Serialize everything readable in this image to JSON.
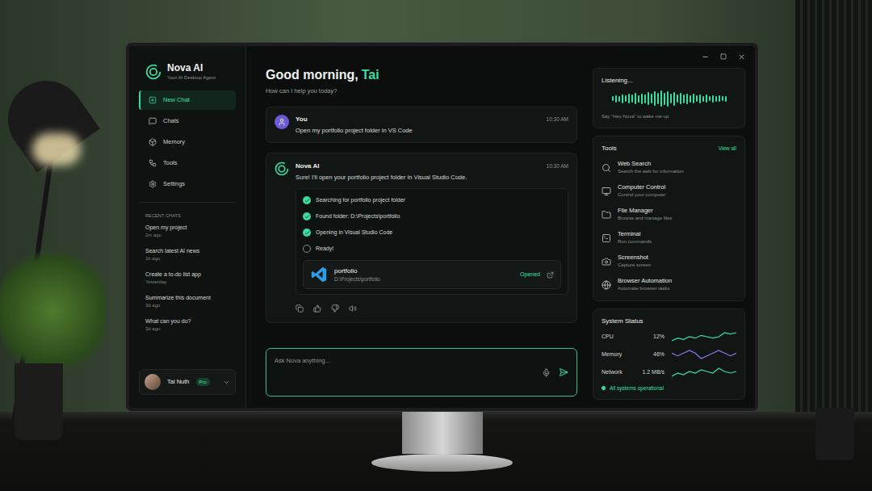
{
  "app": {
    "name": "Nova AI",
    "tagline": "Your AI Desktop Agent"
  },
  "sidebar": {
    "items": [
      {
        "label": "New Chat",
        "selected": true
      },
      {
        "label": "Chats",
        "selected": false
      },
      {
        "label": "Memory",
        "selected": false
      },
      {
        "label": "Tools",
        "selected": false
      },
      {
        "label": "Settings",
        "selected": false
      }
    ],
    "recent_title": "RECENT CHATS",
    "recent": [
      {
        "title": "Open my project",
        "time": "2m ago"
      },
      {
        "title": "Search latest AI news",
        "time": "1h ago"
      },
      {
        "title": "Create a to-do list app",
        "time": "Yesterday"
      },
      {
        "title": "Summarize this document",
        "time": "3d ago"
      },
      {
        "title": "What can you do?",
        "time": "3d ago"
      }
    ]
  },
  "user": {
    "name": "Tai Nuth",
    "badge": "Pro"
  },
  "greeting": {
    "prefix": "Good morning,",
    "name": "Tai",
    "subtitle": "How can I help you today?"
  },
  "messages": [
    {
      "author": "You",
      "time": "10:30 AM",
      "text": "Open my portfolio project folder in VS Code"
    },
    {
      "author": "Nova AI",
      "time": "10:30 AM",
      "text": "Sure! I'll open your portfolio project folder in Visual Studio Code.",
      "steps": [
        {
          "label": "Searching for portfolio project folder",
          "done": true
        },
        {
          "label": "Found folder: D:\\Projects\\portfolio",
          "done": true
        },
        {
          "label": "Opening in Visual Studio Code",
          "done": true
        },
        {
          "label": "Ready!",
          "done": false
        }
      ],
      "result": {
        "name": "portfolio",
        "path": "D:\\Projects\\portfolio",
        "status": "Opened"
      }
    }
  ],
  "input": {
    "placeholder": "Ask Nova anything..."
  },
  "listening": {
    "title": "Listening...",
    "hint": "Say \"Hey Nova\" to wake me up",
    "wave": [
      0.3,
      0.45,
      0.35,
      0.55,
      0.4,
      0.6,
      0.5,
      0.7,
      0.45,
      0.65,
      0.55,
      0.8,
      0.6,
      0.9,
      0.7,
      1.0,
      0.75,
      0.95,
      0.6,
      0.85,
      0.5,
      0.7,
      0.55,
      0.65,
      0.45,
      0.6,
      0.4,
      0.55,
      0.35,
      0.5,
      0.3,
      0.45,
      0.35,
      0.4,
      0.3,
      0.35
    ]
  },
  "tools": {
    "title": "Tools",
    "link": "View all",
    "items": [
      {
        "name": "Web Search",
        "desc": "Search the web for information"
      },
      {
        "name": "Computer Control",
        "desc": "Control your computer"
      },
      {
        "name": "File Manager",
        "desc": "Browse and manage files"
      },
      {
        "name": "Terminal",
        "desc": "Run commands"
      },
      {
        "name": "Screenshot",
        "desc": "Capture screen"
      },
      {
        "name": "Browser Automation",
        "desc": "Automate browser tasks"
      }
    ]
  },
  "system": {
    "title": "System Status",
    "metrics": [
      {
        "label": "CPU",
        "value": "12%",
        "color": "#34e0a1",
        "series": [
          6,
          8,
          7,
          9,
          8,
          10,
          9,
          8,
          9,
          12,
          11,
          12
        ]
      },
      {
        "label": "Memory",
        "value": "46%",
        "color": "#8b7cf6",
        "series": [
          46,
          45,
          46,
          47,
          46,
          44,
          45,
          46,
          47,
          46,
          45,
          46
        ]
      },
      {
        "label": "Network",
        "value": "1.2 MB/s",
        "color": "#34e0a1",
        "series": [
          0.9,
          1.1,
          1.0,
          1.2,
          1.1,
          1.3,
          1.2,
          1.1,
          1.4,
          1.2,
          1.1,
          1.2
        ]
      }
    ],
    "status": "All systems operational"
  }
}
